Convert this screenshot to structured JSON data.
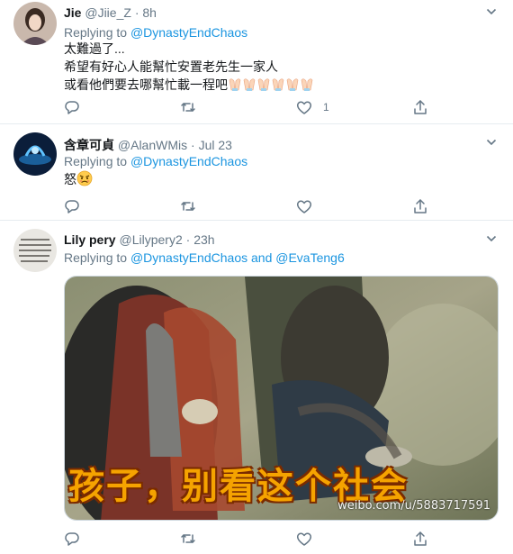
{
  "tweets": [
    {
      "name": "Jie",
      "handle": "@Jiie_Z",
      "sep": "·",
      "time": "8h",
      "replying_prefix": "Replying to",
      "replying_to": "@DynastyEndChaos",
      "lines": [
        "太難過了...",
        "希望有好心人能幫忙安置老先生一家人",
        "或看他們要去哪幫忙載一程吧"
      ],
      "like_count": "1"
    },
    {
      "name": "含章可貞",
      "handle": "@AlanWMis",
      "sep": "·",
      "time": "Jul 23",
      "replying_prefix": "Replying to",
      "replying_to": "@DynastyEndChaos",
      "lines": [
        "怒"
      ]
    },
    {
      "name": "Lily pery",
      "handle": "@Lilypery2",
      "sep": "·",
      "time": "23h",
      "replying_prefix": "Replying to",
      "replying_to": "@DynastyEndChaos",
      "replying_and": "and",
      "replying_to_2": "@EvaTeng6",
      "media_caption": "孩子，别看这个社会",
      "media_watermark": "weibo.com/u/5883717591"
    }
  ],
  "colors": {
    "link": "#1b95e0",
    "muted": "#657786",
    "divider": "#e6ecf0"
  },
  "icons": [
    "reply-icon",
    "retweet-icon",
    "like-icon",
    "share-icon",
    "chevron-down-icon",
    "folded-hands-emoji",
    "angry-face-emoji"
  ]
}
